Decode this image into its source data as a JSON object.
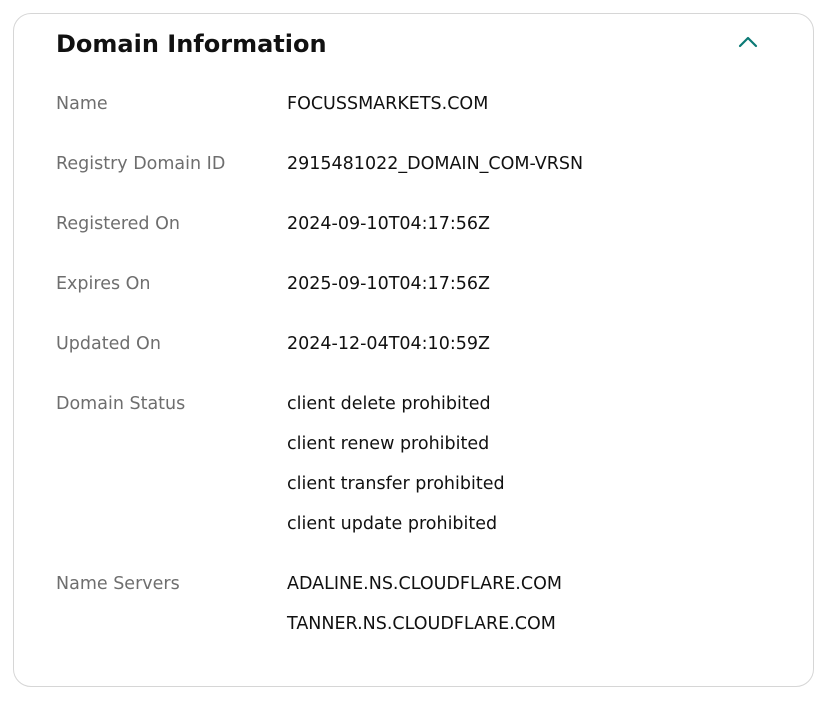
{
  "card": {
    "title": "Domain Information",
    "collapse_icon": "chevron-up-icon",
    "accent_color": "#0b7a75"
  },
  "fields": {
    "name": {
      "label": "Name",
      "values": [
        "FOCUSSMARKETS.COM"
      ]
    },
    "registry_domain_id": {
      "label": "Registry Domain ID",
      "values": [
        "2915481022_DOMAIN_COM-VRSN"
      ]
    },
    "registered_on": {
      "label": "Registered On",
      "values": [
        "2024-09-10T04:17:56Z"
      ]
    },
    "expires_on": {
      "label": "Expires On",
      "values": [
        "2025-09-10T04:17:56Z"
      ]
    },
    "updated_on": {
      "label": "Updated On",
      "values": [
        "2024-12-04T04:10:59Z"
      ]
    },
    "domain_status": {
      "label": "Domain Status",
      "values": [
        "client delete prohibited",
        "client renew prohibited",
        "client transfer prohibited",
        "client update prohibited"
      ]
    },
    "name_servers": {
      "label": "Name Servers",
      "values": [
        "ADALINE.NS.CLOUDFLARE.COM",
        "TANNER.NS.CLOUDFLARE.COM"
      ]
    }
  }
}
